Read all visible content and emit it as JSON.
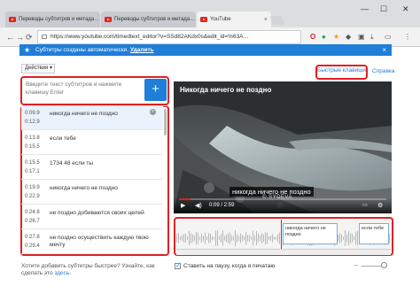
{
  "tabs": [
    {
      "label": "Переводы субтитров и метада…"
    },
    {
      "label": "Переводы субтитров и метада…"
    },
    {
      "label": "YouTube"
    }
  ],
  "window": {
    "min": "—",
    "max": "☐",
    "close": "✕"
  },
  "address": {
    "url": "https://www.youtube.com/timedtext_editor?v=SSd82AKdx0s&edit_id=%63A…"
  },
  "banner": {
    "text": "Субтитры созданы автоматически.",
    "delete": "Удалить"
  },
  "toolbar": {
    "actions_label": "Действия ▾",
    "hotkeys_label": "Быстрые клавиши",
    "help_label": "Справка"
  },
  "editor": {
    "placeholder": "Введите текст субтитров и нажмите клавишу Enter",
    "add_label": "+"
  },
  "subtitles": [
    {
      "start": "0:09.9",
      "end": "0:12.9",
      "text": "никогда ничего не поздно",
      "close": "×"
    },
    {
      "start": "0:13.8",
      "end": "0:15.5",
      "text": "если тебе"
    },
    {
      "start": "0:15.5",
      "end": "0:17.1",
      "text": "1734 48 если ты"
    },
    {
      "start": "0:19.9",
      "end": "0:22.9",
      "text": "никогда ничего не поздно"
    },
    {
      "start": "0:24.8",
      "end": "0:26.7",
      "text": "не поздно добиваются своих целей"
    },
    {
      "start": "0:27.8",
      "end": "0:29.4",
      "text": "не поздно осуществить каждую твою мечту"
    }
  ],
  "video": {
    "title": "Никогда ничего не поздно",
    "subtitle": "никогда ничего не поздно",
    "watermark": "© SYDEVA",
    "time": "0:09 / 2:59",
    "progress": 0.055
  },
  "timeline": {
    "segments": [
      {
        "text": "никогда ничего не поздно"
      },
      {
        "text": "если тебе"
      }
    ]
  },
  "footer": {
    "hint": "Хотите добавить субтитры быстрее? Узнайте, как сделать это",
    "hint_link": "здесь.",
    "pause_label": "Ставить на паузу, когда я печатаю"
  }
}
